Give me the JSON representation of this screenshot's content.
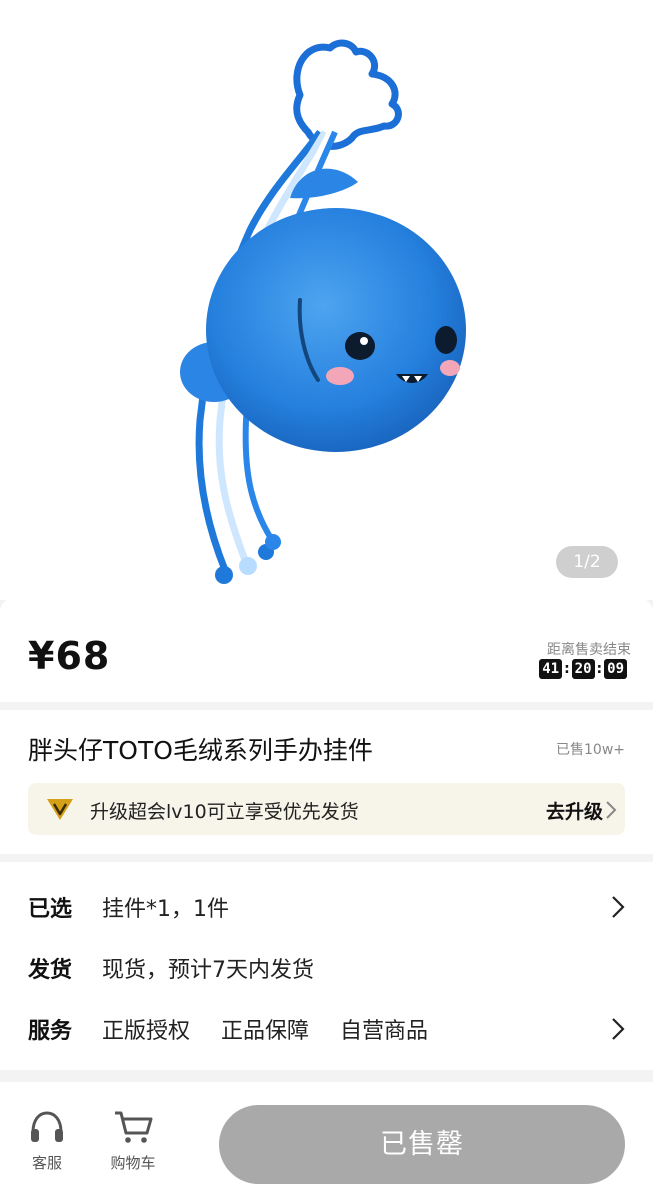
{
  "gallery": {
    "pager": "1/2",
    "image_desc_icon": "plush-keychain-image"
  },
  "price": {
    "value": "¥68"
  },
  "countdown": {
    "label": "距离售卖结束",
    "hours": "41",
    "minutes": "20",
    "seconds": "09"
  },
  "product": {
    "title": "胖头仔TOTO毛绒系列手办挂件",
    "sold": "已售10w+"
  },
  "promo": {
    "text": "升级超会lv10可立享受优先发货",
    "action": "去升级",
    "icon": "vip-diamond-icon",
    "accent": "#d4a017"
  },
  "specs": {
    "selected": {
      "key": "已选",
      "value": "挂件*1，1件"
    },
    "shipping": {
      "key": "发货",
      "value": "现货，预计7天内发货"
    },
    "service": {
      "key": "服务",
      "values": [
        "正版授权",
        "正品保障",
        "自营商品"
      ]
    }
  },
  "bottom": {
    "service_label": "客服",
    "cart_label": "购物车",
    "buy_label": "已售罄",
    "buy_color": "#a9a9a9"
  }
}
